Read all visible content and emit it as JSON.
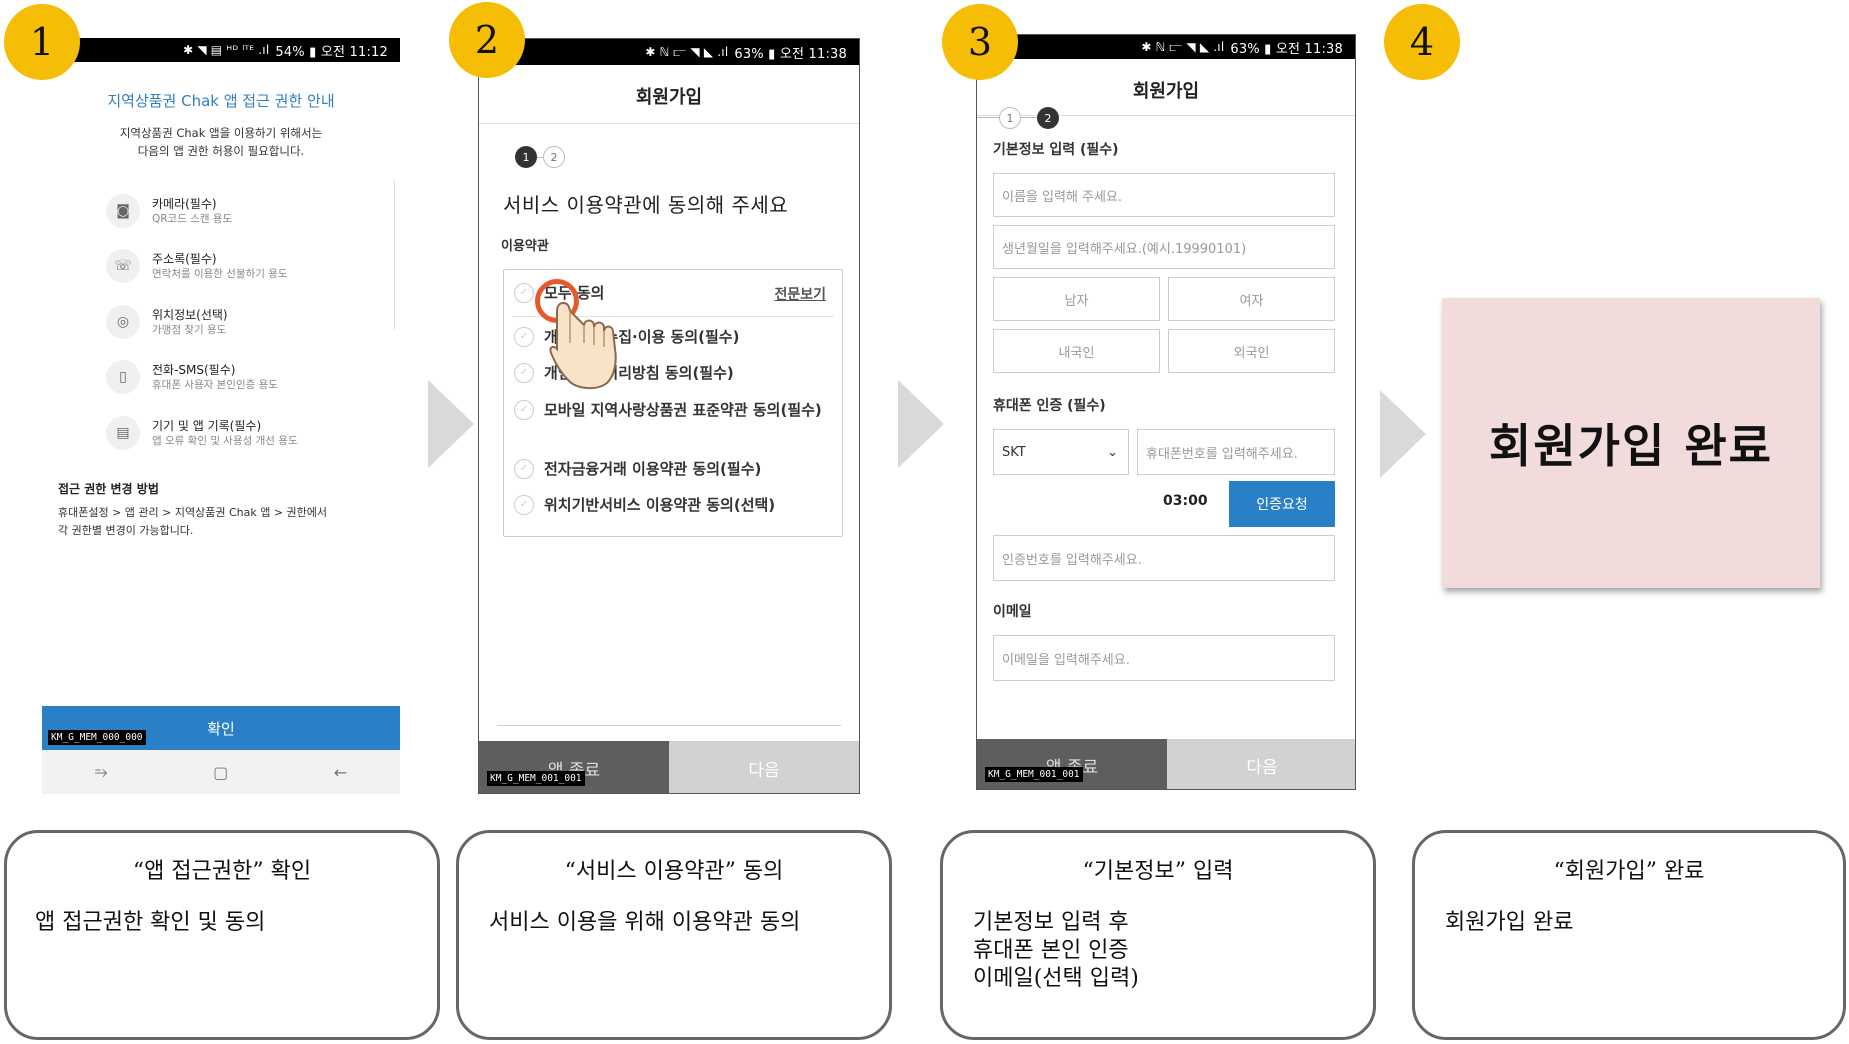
{
  "steps": [
    "1",
    "2",
    "3",
    "4"
  ],
  "screen1": {
    "status_text": "54% ▮ 오전 11:12",
    "status_icons": "✱ ◥ ▤ ᴴᴰ ˡᵀᴱ .ıl",
    "title": "지역상품권 Chak 앱 접근 권한 안내",
    "desc_line1": "지역상품권 Chak 앱을 이용하기 위해서는",
    "desc_line2": "다음의 앱 권한 허용이 필요합니다.",
    "permissions": [
      {
        "icon": "camera-icon",
        "glyph": "◙",
        "title": "카메라(필수)",
        "sub": "QR코드 스캔 용도"
      },
      {
        "icon": "phonebook-icon",
        "glyph": "☏",
        "title": "주소록(필수)",
        "sub": "연락처를 이용한 선물하기 용도"
      },
      {
        "icon": "location-icon",
        "glyph": "◎",
        "title": "위치정보(선택)",
        "sub": "가맹점 찾기 용도"
      },
      {
        "icon": "phone-icon",
        "glyph": "▯",
        "title": "전화-SMS(필수)",
        "sub": "휴대폰 사용자 본인인증 용도"
      },
      {
        "icon": "device-log-icon",
        "glyph": "▤",
        "title": "기기 및 앱 기록(필수)",
        "sub": "앱 오류 확인 및 사용성 개선 용도"
      }
    ],
    "help_title": "접근 권한 변경 방법",
    "help_line1": "휴대폰설정 > 앱 관리 > 지역상품권 Chak 앱 > 권한에서",
    "help_line2": "각 권한별 변경이 가능합니다.",
    "confirm_label": "확인",
    "code": "KM_G_MEM_000_000",
    "nav": [
      "⥱",
      "▢",
      "←"
    ]
  },
  "screen2": {
    "status_text": "63% ▮ 오전 11:38",
    "status_icons": "✱ ℕ ⫍ ◥ ◣ .ıl",
    "header": "회원가입",
    "step1": "1",
    "step2": "2",
    "heading": "서비스 이용약관에 동의해 주세요",
    "sub": "이용약관",
    "all_agree": "모두 동의",
    "full_view": "전문보기",
    "terms": [
      "개인정보 수집·이용 동의(필수)",
      "개인정보 처리방침 동의(필수)",
      "모바일 지역사랑상품권 표준약관 동의(필수)",
      "전자금융거래 이용약관 동의(필수)",
      "위치기반서비스 이용약관 동의(선택)"
    ],
    "btn_left": "앱 종료",
    "btn_right": "다음",
    "code": "KM_G_MEM_001_001"
  },
  "screen3": {
    "status_text": "63% ▮ 오전 11:38",
    "status_icons": "✱ ℕ ⫍ ◥ ◣ .ıl",
    "header": "회원가입",
    "step1": "1",
    "step2": "2",
    "basic_label": "기본정보 입력 (필수)",
    "name_placeholder": "이름을 입력해 주세요.",
    "birth_placeholder": "생년월일을 입력해주세요.(예시.19990101)",
    "male": "남자",
    "female": "여자",
    "domestic": "내국인",
    "foreign": "외국인",
    "phone_label": "휴대폰 인증 (필수)",
    "carrier": "SKT",
    "phone_placeholder": "휴대폰번호를 입력해주세요.",
    "timer": "03:00",
    "auth_btn": "인증요청",
    "code_placeholder": "인증번호를 입력해주세요.",
    "email_label": "이메일",
    "email_placeholder": "이메일을 입력해주세요.",
    "btn_left": "앱 종료",
    "btn_right": "다음",
    "code": "KM_G_MEM_001_001"
  },
  "done_card": "회원가입 완료",
  "captions": [
    {
      "title": "“앱 접근권한” 확인",
      "body": "앱 접근권한 확인 및 동의"
    },
    {
      "title": "“서비스 이용약관” 동의",
      "body": "서비스 이용을 위해 이용약관 동의"
    },
    {
      "title": "“기본정보” 입력",
      "body": "기본정보 입력 후\n휴대폰 본인 인증\n이메일(선택 입력)"
    },
    {
      "title": "“회원가입” 완료",
      "body": "회원가입 완료"
    }
  ],
  "colors": {
    "badge": "#f5bd05",
    "accent_blue": "#2a80c7",
    "done_card": "#f2dcdb",
    "tap_ring": "#e8582d"
  }
}
